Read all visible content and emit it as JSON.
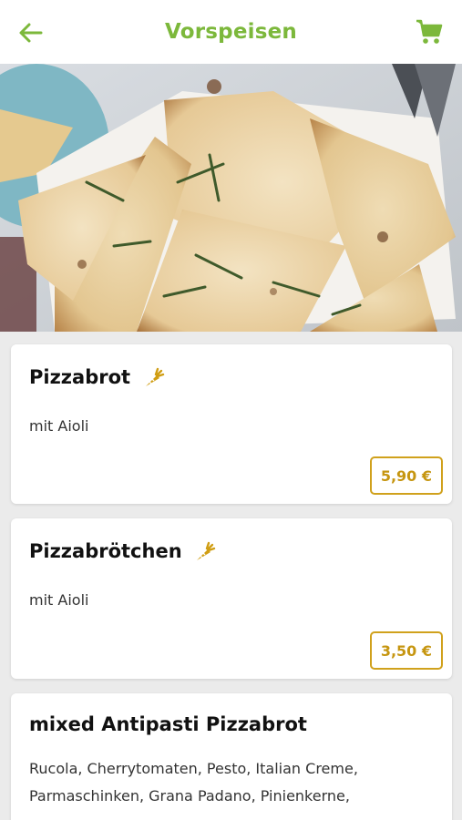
{
  "header": {
    "title": "Vorspeisen",
    "back_icon": "arrow-left-icon",
    "cart_icon": "shopping-cart-icon"
  },
  "colors": {
    "brand_green": "#7cb83b",
    "price_gold": "#c69611",
    "background": "#ebebeb"
  },
  "hero": {
    "image": "pizza-bread-photo"
  },
  "items": [
    {
      "name": "Pizzabrot",
      "description": "mit Aioli",
      "price": "5,90 €",
      "veg_icon": "carrot-icon"
    },
    {
      "name": "Pizzabrötchen",
      "description": "mit Aioli",
      "price": "3,50 €",
      "veg_icon": "carrot-icon"
    },
    {
      "name": "mixed Antipasti Pizzabrot",
      "description_lines": [
        "Rucola, Cherrytomaten, Pesto, Italian Creme,",
        "Parmaschinken, Grana Padano, Pinienkerne,"
      ]
    }
  ]
}
